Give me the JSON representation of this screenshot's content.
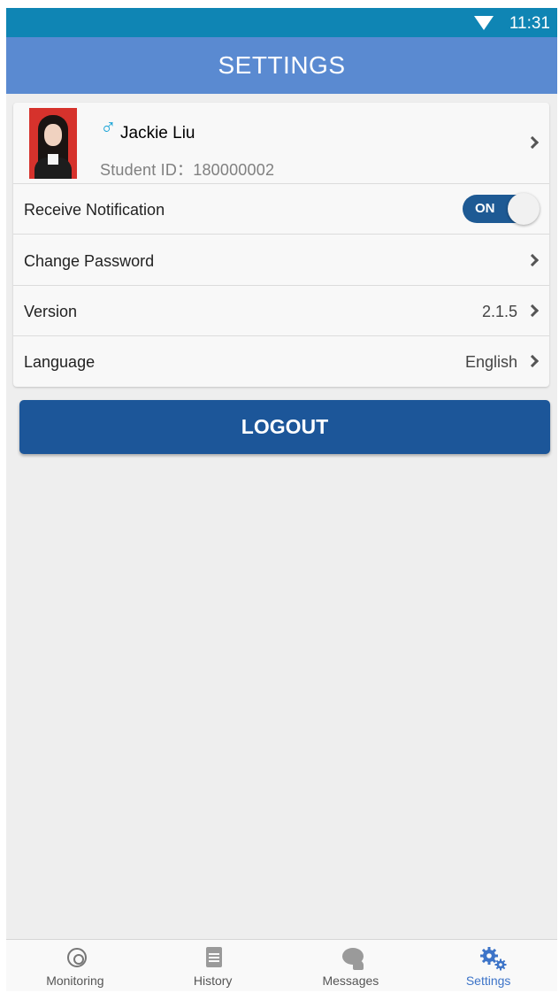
{
  "status_bar": {
    "time": "11:31",
    "wifi_icon": "wifi-icon"
  },
  "app_bar": {
    "title": "SETTINGS"
  },
  "profile": {
    "name": "Jackie Liu",
    "gender_symbol": "♂",
    "student_id": "Student ID：180000002",
    "avatar_icon": "avatar"
  },
  "settings": {
    "notification": {
      "label": "Receive Notification",
      "toggle": "ON"
    },
    "password": {
      "label": "Change Password"
    },
    "version": {
      "label": "Version",
      "value": "2.1.5"
    },
    "language": {
      "label": "Language",
      "value": "English"
    }
  },
  "logout_label": "LOGOUT",
  "tabs": [
    {
      "label": "Monitoring",
      "icon": "monitoring-icon"
    },
    {
      "label": "History",
      "icon": "document-icon"
    },
    {
      "label": "Messages",
      "icon": "chat-bubble-icon"
    },
    {
      "label": "Settings",
      "icon": "gears-icon",
      "active": true
    }
  ],
  "colors": {
    "status_bar": "#0f85b4",
    "app_bar": "#5a8ad1",
    "logout": "#1c5699",
    "toggle_on": "#1e5a94",
    "active_tab": "#3d74c8"
  }
}
